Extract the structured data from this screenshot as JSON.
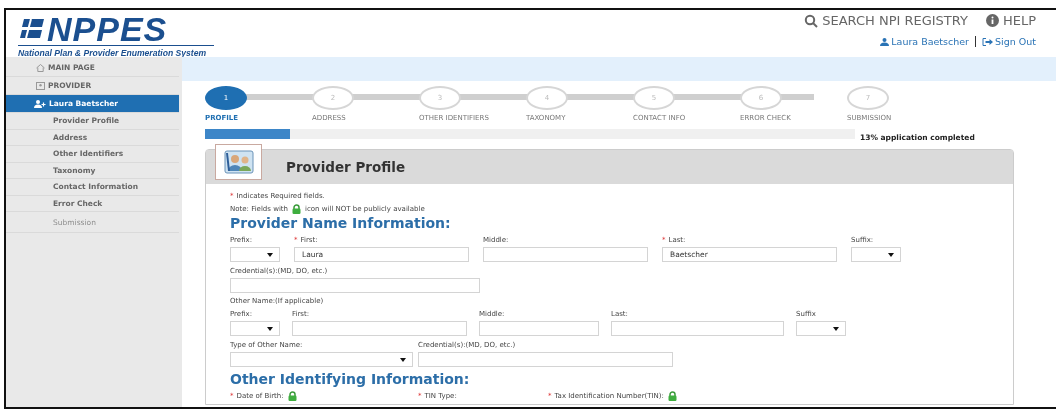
{
  "header": {
    "logo_title": "NPPES",
    "logo_subtitle": "National Plan & Provider Enumeration System",
    "links": [
      {
        "label": "SEARCH NPI REGISTRY",
        "kind": "search"
      },
      {
        "label": "HELP",
        "kind": "help"
      }
    ],
    "user": "Laura Baetscher",
    "sign_out": "Sign Out"
  },
  "sidebar": {
    "items": [
      {
        "label": "MAIN PAGE",
        "kind": "home",
        "selected": false,
        "disabled": false
      },
      {
        "label": "PROVIDER",
        "kind": "provider",
        "selected": false,
        "disabled": false
      },
      {
        "label": "Laura Baetscher",
        "kind": "user",
        "selected": true,
        "disabled": false
      },
      {
        "label": "Provider Profile",
        "kind": "sub",
        "selected": false,
        "disabled": false
      },
      {
        "label": "Address",
        "kind": "sub",
        "selected": false,
        "disabled": false
      },
      {
        "label": "Other Identifiers",
        "kind": "sub",
        "selected": false,
        "disabled": false
      },
      {
        "label": "Taxonomy",
        "kind": "sub",
        "selected": false,
        "disabled": false
      },
      {
        "label": "Contact Information",
        "kind": "sub",
        "selected": false,
        "disabled": false
      },
      {
        "label": "Error Check",
        "kind": "sub",
        "selected": false,
        "disabled": false
      },
      {
        "label": "Submission",
        "kind": "sub",
        "selected": false,
        "disabled": true
      }
    ]
  },
  "steps": [
    {
      "number": "1",
      "label": "PROFILE",
      "selected": true
    },
    {
      "number": "2",
      "label": "ADDRESS",
      "selected": false
    },
    {
      "number": "3",
      "label": "OTHER IDENTIFIERS",
      "selected": false
    },
    {
      "number": "4",
      "label": "TAXONOMY",
      "selected": false
    },
    {
      "number": "5",
      "label": "CONTACT INFO",
      "selected": false
    },
    {
      "number": "6",
      "label": "ERROR CHECK",
      "selected": false
    },
    {
      "number": "7",
      "label": "SUBMISSION",
      "selected": false
    }
  ],
  "progress": {
    "level": 0.13,
    "text": "13% application completed"
  },
  "panel": {
    "title": "Provider Profile",
    "required_note": {
      "mark": "*",
      "text": "Indicates Required fields."
    },
    "privacy_note": {
      "before": "Note: Fields with",
      "after": "icon will NOT be publicly available"
    },
    "sections": [
      {
        "heading": "Provider Name Information:",
        "rows": [
          {
            "kind": "fields",
            "fields": [
              {
                "label": "Prefix:",
                "kind": "select"
              },
              {
                "label": "First:",
                "required_mark": "*",
                "kind": "text",
                "value": "Laura"
              },
              {
                "label": "Middle:",
                "kind": "text"
              },
              {
                "label": "Last:",
                "required_mark": "*",
                "kind": "text",
                "value": "Baetscher"
              },
              {
                "label": "Suffix:",
                "kind": "select"
              }
            ]
          },
          {
            "kind": "fields",
            "fields": [
              {
                "label": "Credential(s):(MD, DO, etc.)",
                "kind": "text"
              }
            ]
          },
          {
            "kind": "subheading",
            "text": "Other Name:(If applicable)"
          },
          {
            "kind": "fields",
            "fields": [
              {
                "label": "Prefix:",
                "kind": "select"
              },
              {
                "label": "First:",
                "kind": "text"
              },
              {
                "label": "Middle:",
                "kind": "text"
              },
              {
                "label": "Last:",
                "kind": "text"
              },
              {
                "label": "Suffix",
                "kind": "select"
              }
            ]
          },
          {
            "kind": "fields",
            "fields": [
              {
                "label": "Type of Other Name:",
                "kind": "select"
              },
              {
                "label": "Credential(s):(MD, DO, etc.)",
                "kind": "text"
              }
            ]
          }
        ]
      },
      {
        "heading": "Other Identifying Information:",
        "rows": [
          {
            "kind": "fields",
            "fields": [
              {
                "label": "Date of Birth:",
                "required_mark": "*",
                "kind": "label",
                "private": true
              },
              {
                "label": "TIN Type:",
                "required_mark": "*",
                "kind": "label"
              },
              {
                "label": "Tax Identification Number(TIN):",
                "required_mark": "*",
                "kind": "label",
                "private": true
              }
            ]
          }
        ]
      }
    ]
  }
}
